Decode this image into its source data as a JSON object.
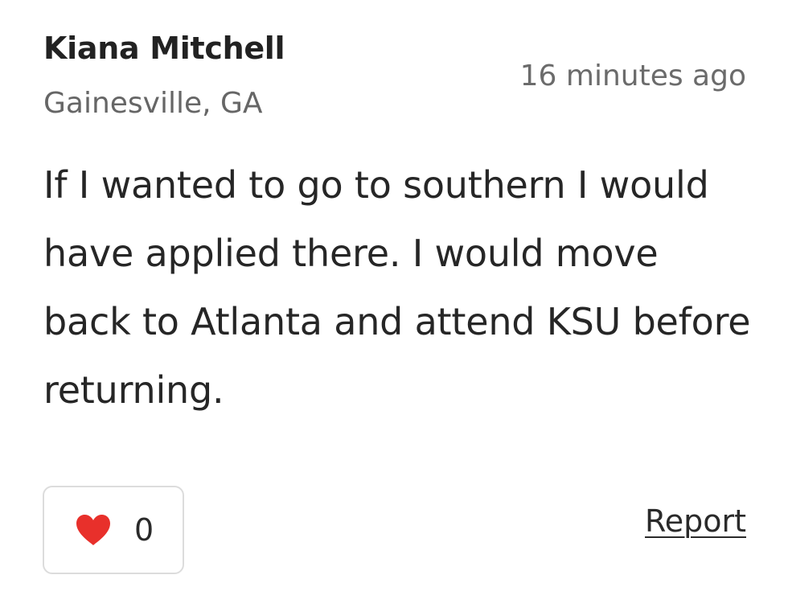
{
  "comment": {
    "author": {
      "name": "Kiana Mitchell",
      "location": "Gainesville, GA"
    },
    "timestamp": "16 minutes ago",
    "body": "If I wanted to go to southern I would have applied there. I would move back to Atlanta and attend KSU before returning.",
    "likes": {
      "count": "0",
      "icon": "heart-icon",
      "icon_color": "#e8302b"
    },
    "report_label": "Report"
  }
}
